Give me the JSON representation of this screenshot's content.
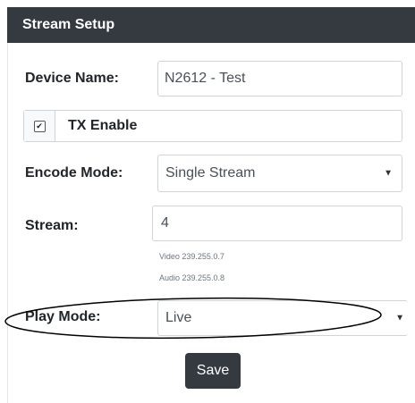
{
  "header": {
    "title": "Stream Setup"
  },
  "device_name": {
    "label": "Device Name:",
    "value": "N2612 - Test"
  },
  "tx_enable": {
    "label": "TX Enable",
    "checked": true,
    "check_glyph": "✔"
  },
  "encode_mode": {
    "label": "Encode Mode:",
    "value": "Single Stream",
    "arrow": "▼"
  },
  "stream": {
    "label": "Stream:",
    "value": "4",
    "video_info": "Video 239.255.0.7",
    "audio_info": "Audio 239.255.0.8"
  },
  "play_mode": {
    "label": "Play Mode:",
    "value": "Live",
    "arrow": "▼"
  },
  "save_button": {
    "label": "Save"
  },
  "colors": {
    "header_bg": "#343a40",
    "button_bg": "#343a40",
    "border": "#ced4da"
  }
}
